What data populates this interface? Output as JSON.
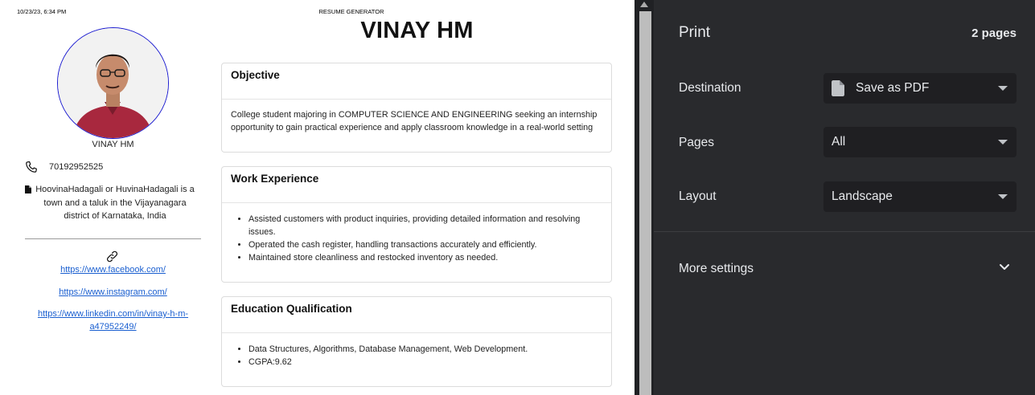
{
  "preview": {
    "header_date": "10/23/23, 6:34 PM",
    "header_title": "RESUME GENERATOR",
    "name_small": "VINAY HM",
    "phone": "70192952525",
    "address": "HoovinaHadagali or HuvinaHadagali is a town and a taluk in the Vijayanagara district of Karnataka, India",
    "links": [
      "https://www.facebook.com/",
      "https://www.instagram.com/",
      "https://www.linkedin.com/in/vinay-h-m-a47952249/"
    ],
    "name_big": "VINAY HM",
    "objective": {
      "heading": "Objective",
      "text": "College student majoring in COMPUTER SCIENCE AND ENGINEERING seeking an internship opportunity to gain practical experience and apply classroom knowledge in a real-world setting"
    },
    "work": {
      "heading": "Work Experience",
      "items": [
        "Assisted customers with product inquiries, providing detailed information and resolving issues.",
        "Operated the cash register, handling transactions accurately and efficiently.",
        "Maintained store cleanliness and restocked inventory as needed."
      ]
    },
    "education": {
      "heading": "Education Qualification",
      "items": [
        "Data Structures, Algorithms, Database Management, Web Development.",
        "CGPA:9.62"
      ]
    }
  },
  "print_panel": {
    "title": "Print",
    "pages_count": "2 pages",
    "destination_label": "Destination",
    "destination_value": "Save as PDF",
    "pages_label": "Pages",
    "pages_value": "All",
    "layout_label": "Layout",
    "layout_value": "Landscape",
    "more_settings": "More settings"
  },
  "icons": {
    "phone": "phone-icon",
    "address": "document-icon",
    "link": "link-icon",
    "destination": "pdf-file-icon",
    "dropdown": "caret-down-icon",
    "more": "chevron-down-icon"
  },
  "colors": {
    "panel_bg": "#292a2d",
    "select_bg": "#1f1f22",
    "link": "#1a5fd0",
    "photo_border": "#1a1ad0"
  }
}
